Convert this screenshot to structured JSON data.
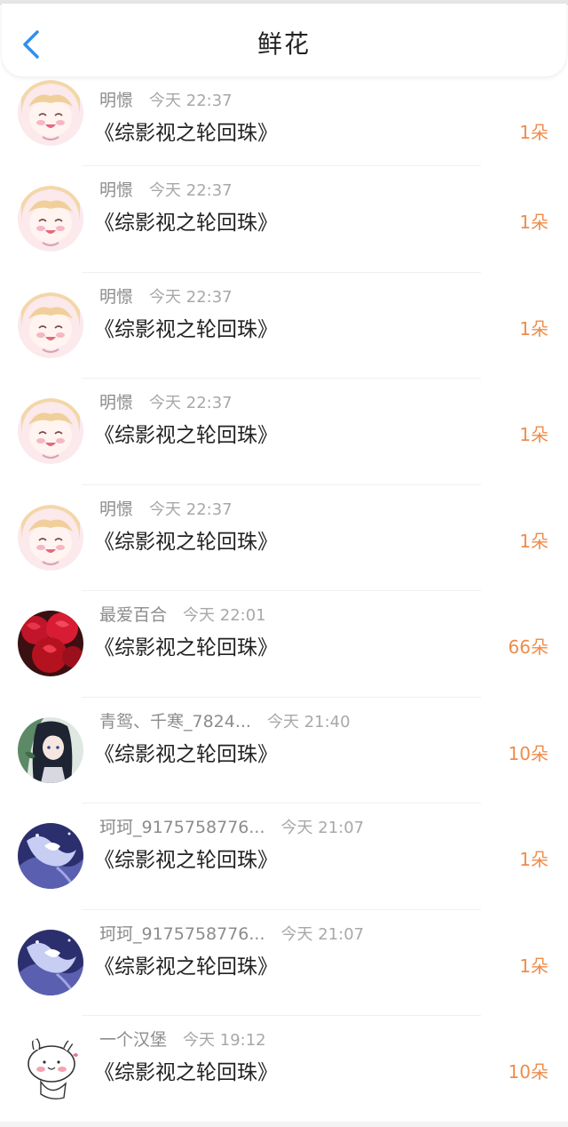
{
  "header": {
    "title": "鲜花"
  },
  "items": [
    {
      "name": "明憬",
      "time": "今天 22:37",
      "book": "《综影视之轮回珠》",
      "count": "1朵",
      "avatar": "anime-girl"
    },
    {
      "name": "明憬",
      "time": "今天 22:37",
      "book": "《综影视之轮回珠》",
      "count": "1朵",
      "avatar": "anime-girl"
    },
    {
      "name": "明憬",
      "time": "今天 22:37",
      "book": "《综影视之轮回珠》",
      "count": "1朵",
      "avatar": "anime-girl"
    },
    {
      "name": "明憬",
      "time": "今天 22:37",
      "book": "《综影视之轮回珠》",
      "count": "1朵",
      "avatar": "anime-girl"
    },
    {
      "name": "明憬",
      "time": "今天 22:37",
      "book": "《综影视之轮回珠》",
      "count": "1朵",
      "avatar": "anime-girl"
    },
    {
      "name": "最爱百合",
      "time": "今天 22:01",
      "book": "《综影视之轮回珠》",
      "count": "66朵",
      "avatar": "red-roses"
    },
    {
      "name": "青鸳、千寒_7824...",
      "time": "今天 21:40",
      "book": "《综影视之轮回珠》",
      "count": "10朵",
      "avatar": "dark-hair-girl"
    },
    {
      "name": "珂珂_9175758776...",
      "time": "今天 21:07",
      "book": "《综影视之轮回珠》",
      "count": "1朵",
      "avatar": "fox-spirit"
    },
    {
      "name": "珂珂_9175758776...",
      "time": "今天 21:07",
      "book": "《综影视之轮回珠》",
      "count": "1朵",
      "avatar": "fox-spirit"
    },
    {
      "name": "一个汉堡",
      "time": "今天 19:12",
      "book": "《综影视之轮回珠》",
      "count": "10朵",
      "avatar": "bunny-sketch"
    }
  ],
  "colors": {
    "accent_blue": "#2f8ff0",
    "count_orange": "#ef8c4a"
  }
}
